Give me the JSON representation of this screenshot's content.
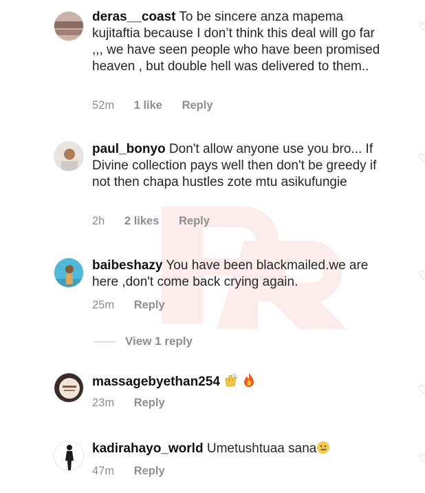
{
  "comments": [
    {
      "username": "deras__coast",
      "text": "To be sincere anza mapema kujitaftia because I don’t think this deal will go far ,,, we have seen people who have been promised heaven , but double hell was delivered to them..",
      "time": "52m",
      "likes": "1 like",
      "reply": "Reply",
      "avatar_colors": [
        "#8a6a62",
        "#c9b2a6"
      ]
    },
    {
      "username": "paul_bonyo",
      "text": "Don't allow anyone use you bro... If Divine collection pays well then don't be greedy if not then chapa hustles zote mtu asikufungie",
      "time": "2h",
      "likes": "2 likes",
      "reply": "Reply",
      "avatar_colors": [
        "#d9d6d1",
        "#b07a55"
      ]
    },
    {
      "username": "baibeshazy",
      "text": "You have been blackmailed.we are here ,don't come back crying again.",
      "time": "25m",
      "likes": "",
      "reply": "Reply",
      "avatar_colors": [
        "#4fb9d8",
        "#e0a55a"
      ]
    },
    {
      "username": "massagebyethan254",
      "text": "",
      "emoji": [
        "clapping-hands",
        "fire"
      ],
      "time": "23m",
      "likes": "",
      "reply": "Reply",
      "avatar_colors": [
        "#3a2b28",
        "#efe4d6"
      ]
    },
    {
      "username": "kadirahayo_world",
      "text": "Umetushtuaa sana",
      "emoji": [
        "crying-face"
      ],
      "time": "47m",
      "likes": "",
      "reply": "Reply",
      "avatar_colors": [
        "#ffffff",
        "#1c1c1c"
      ]
    }
  ],
  "view_replies_label": "View 1 reply",
  "colors": {
    "text": "#262626",
    "meta": "#8e8e8e",
    "watermark": "#e33b3b"
  }
}
